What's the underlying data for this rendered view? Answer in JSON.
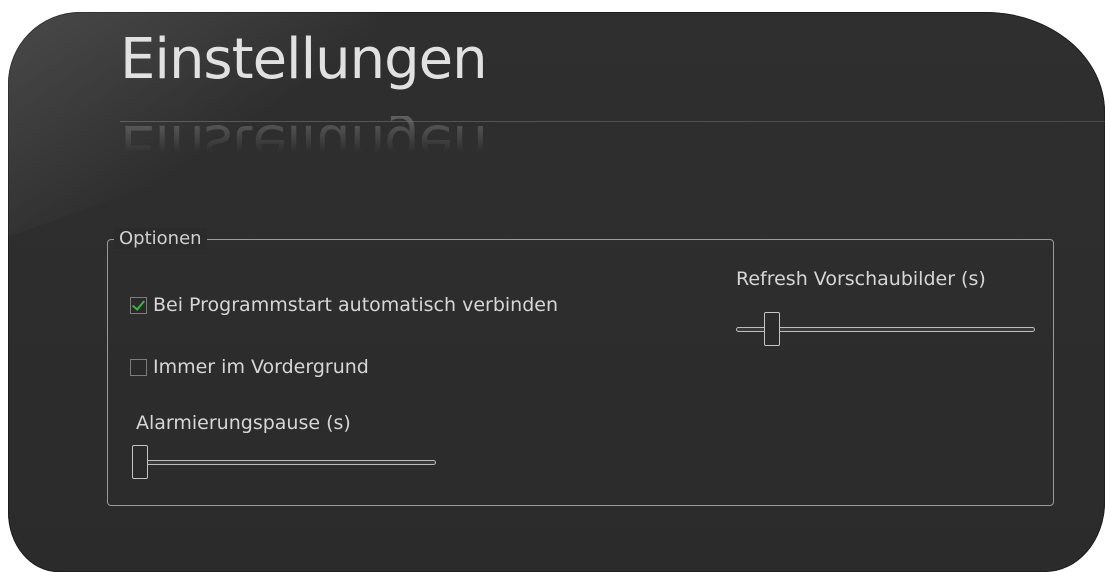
{
  "title": "Einstellungen",
  "options": {
    "group_label": "Optionen",
    "auto_connect": {
      "label": "Bei Programmstart automatisch verbinden",
      "checked": true
    },
    "always_on_top": {
      "label": "Immer im Vordergrund",
      "checked": false
    },
    "alarm_pause": {
      "label": "Alarmierungspause (s)",
      "level": 0.0
    },
    "refresh_preview": {
      "label": "Refresh Vorschaubilder (s)",
      "level": 0.1
    }
  },
  "colors": {
    "background": "#2b2b2b",
    "text": "#d6d6d6",
    "check": "#3fb23f"
  }
}
